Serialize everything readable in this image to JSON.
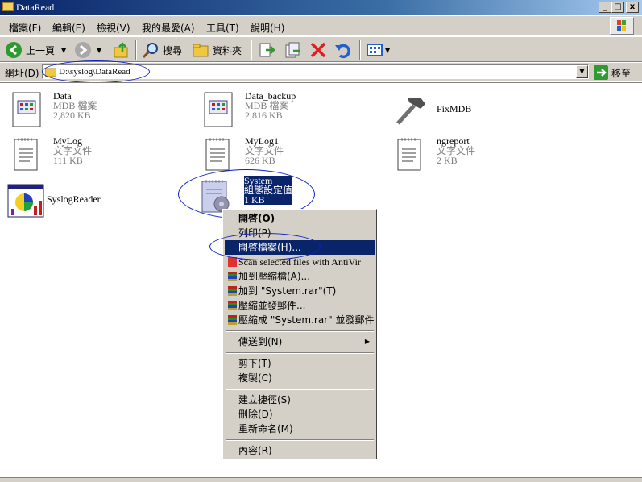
{
  "window": {
    "title": "DataRead",
    "controls": {
      "minimize": "_",
      "maximize": "□",
      "close": "x"
    }
  },
  "menu": [
    "檔案(F)",
    "編輯(E)",
    "檢視(V)",
    "我的最愛(A)",
    "工具(T)",
    "說明(H)"
  ],
  "toolbar": {
    "back_label": "上一頁",
    "search_label": "搜尋",
    "folders_label": "資料夾"
  },
  "address": {
    "label": "網址(D)",
    "value": "D:\\syslog\\DataRead",
    "go_label": "移至"
  },
  "files": [
    {
      "name": "Data",
      "type": "MDB 檔案",
      "size": "2,820 KB",
      "icon": "mdb-file-icon"
    },
    {
      "name": "Data_backup",
      "type": "MDB 檔案",
      "size": "2,816 KB",
      "icon": "mdb-file-icon"
    },
    {
      "name": "FixMDB",
      "type": "",
      "size": "",
      "icon": "hammer-icon"
    },
    {
      "name": "MyLog",
      "type": "文字文件",
      "size": "111 KB",
      "icon": "text-file-icon"
    },
    {
      "name": "MyLog1",
      "type": "文字文件",
      "size": "626 KB",
      "icon": "text-file-icon"
    },
    {
      "name": "ngreport",
      "type": "文字文件",
      "size": "2 KB",
      "icon": "text-file-icon"
    },
    {
      "name": "SyslogReader",
      "type": "",
      "size": "",
      "icon": "chart-app-icon"
    },
    {
      "name": "System",
      "type": "組態設定值",
      "size": "1 KB",
      "icon": "config-file-icon"
    }
  ],
  "context_menu": {
    "items": [
      "開啓(O)",
      "列印(P)",
      "開啓檔案(H)...",
      "Scan selected files with AntiVir",
      "加到壓縮檔(A)...",
      "加到 \"System.rar\"(T)",
      "壓縮並發郵件...",
      "壓縮成 \"System.rar\" 並發郵件",
      "傳送到(N)",
      "剪下(T)",
      "複製(C)",
      "建立捷徑(S)",
      "刪除(D)",
      "重新命名(M)",
      "內容(R)"
    ],
    "highlighted": "開啓檔案(H)..."
  },
  "colors": {
    "highlight": "#0a246a",
    "annotation_ring": "#1020c0",
    "face": "#d4d0c8"
  }
}
